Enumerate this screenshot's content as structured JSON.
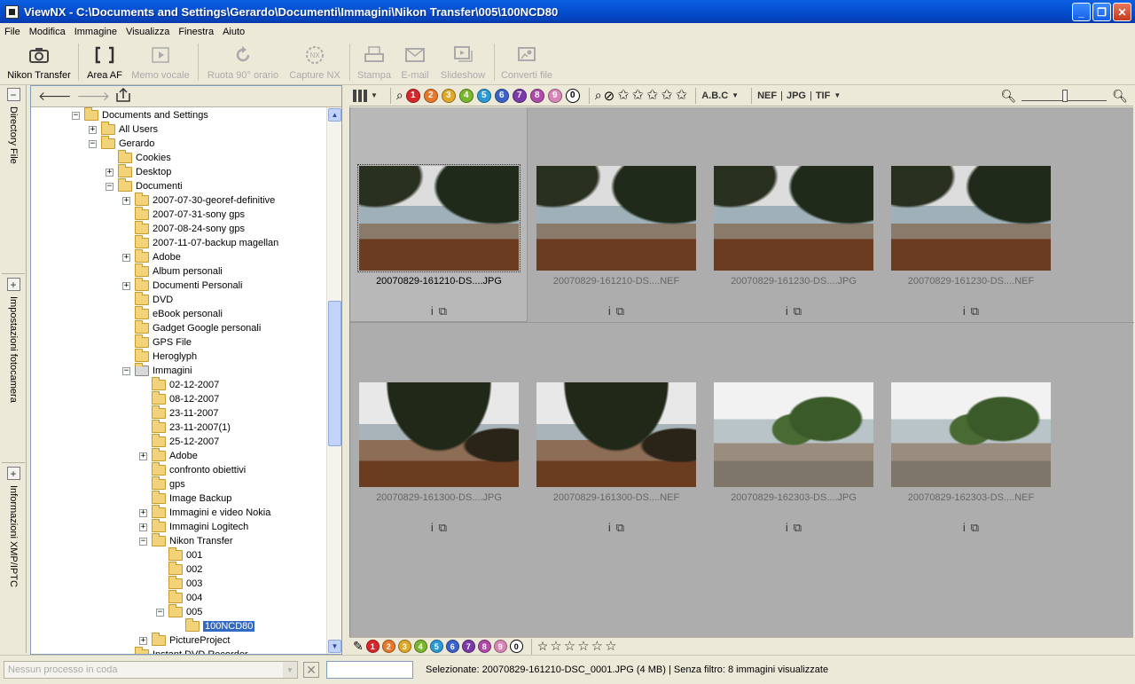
{
  "window": {
    "title": "ViewNX - C:\\Documents and Settings\\Gerardo\\Documenti\\Immagini\\Nikon Transfer\\005\\100NCD80",
    "minimize_glyph": "_",
    "maximize_glyph": "❐",
    "close_glyph": "✕"
  },
  "menu": [
    {
      "label": "File"
    },
    {
      "label": "Modifica"
    },
    {
      "label": "Immagine"
    },
    {
      "label": "Visualizza"
    },
    {
      "label": "Finestra"
    },
    {
      "label": "Aiuto"
    }
  ],
  "toolbar": {
    "nikon_transfer": "Nikon Transfer",
    "area_af": "Area AF",
    "memo_vocale": "Memo vocale",
    "ruota": "Ruota 90° orario",
    "capture_nx": "Capture NX",
    "stampa": "Stampa",
    "email": "E-mail",
    "slideshow": "Slideshow",
    "converti": "Converti file"
  },
  "side_tabs": {
    "directory": "Directory File",
    "camera": "Impostazioni fotocamera",
    "xmp": "Informazioni XMP/IPTC"
  },
  "tree": [
    {
      "label": "Documents and Settings",
      "level": 0,
      "exp": "-"
    },
    {
      "label": "All Users",
      "level": 1,
      "exp": "+"
    },
    {
      "label": "Gerardo",
      "level": 1,
      "exp": "-"
    },
    {
      "label": "Cookies",
      "level": 2,
      "exp": ""
    },
    {
      "label": "Desktop",
      "level": 2,
      "exp": "+"
    },
    {
      "label": "Documenti",
      "level": 2,
      "exp": "-"
    },
    {
      "label": "2007-07-30-georef-definitive",
      "level": 3,
      "exp": "+"
    },
    {
      "label": "2007-07-31-sony gps",
      "level": 3,
      "exp": ""
    },
    {
      "label": "2007-08-24-sony gps",
      "level": 3,
      "exp": ""
    },
    {
      "label": "2007-11-07-backup magellan",
      "level": 3,
      "exp": ""
    },
    {
      "label": "Adobe",
      "level": 3,
      "exp": "+"
    },
    {
      "label": "Album personali",
      "level": 3,
      "exp": ""
    },
    {
      "label": "Documenti Personali",
      "level": 3,
      "exp": "+"
    },
    {
      "label": "DVD",
      "level": 3,
      "exp": ""
    },
    {
      "label": "eBook personali",
      "level": 3,
      "exp": ""
    },
    {
      "label": "Gadget Google personali",
      "level": 3,
      "exp": ""
    },
    {
      "label": "GPS File",
      "level": 3,
      "exp": ""
    },
    {
      "label": "Heroglyph",
      "level": 3,
      "exp": ""
    },
    {
      "label": "Immagini",
      "level": 3,
      "exp": "-",
      "special": true
    },
    {
      "label": "02-12-2007",
      "level": 4,
      "exp": ""
    },
    {
      "label": "08-12-2007",
      "level": 4,
      "exp": ""
    },
    {
      "label": "23-11-2007",
      "level": 4,
      "exp": ""
    },
    {
      "label": "23-11-2007(1)",
      "level": 4,
      "exp": ""
    },
    {
      "label": "25-12-2007",
      "level": 4,
      "exp": ""
    },
    {
      "label": "Adobe",
      "level": 4,
      "exp": "+"
    },
    {
      "label": "confronto obiettivi",
      "level": 4,
      "exp": ""
    },
    {
      "label": "gps",
      "level": 4,
      "exp": ""
    },
    {
      "label": "Image Backup",
      "level": 4,
      "exp": ""
    },
    {
      "label": "Immagini e video Nokia",
      "level": 4,
      "exp": "+"
    },
    {
      "label": "Immagini Logitech",
      "level": 4,
      "exp": "+"
    },
    {
      "label": "Nikon Transfer",
      "level": 4,
      "exp": "-"
    },
    {
      "label": "001",
      "level": 5,
      "exp": ""
    },
    {
      "label": "002",
      "level": 5,
      "exp": ""
    },
    {
      "label": "003",
      "level": 5,
      "exp": ""
    },
    {
      "label": "004",
      "level": 5,
      "exp": ""
    },
    {
      "label": "005",
      "level": 5,
      "exp": "-"
    },
    {
      "label": "100NCD80",
      "level": 6,
      "exp": "",
      "selected": true
    },
    {
      "label": "PictureProject",
      "level": 4,
      "exp": "+"
    },
    {
      "label": "Instant DVD Recorder",
      "level": 3,
      "exp": ""
    }
  ],
  "label_filters": [
    {
      "n": "1",
      "color": "#d8262a"
    },
    {
      "n": "2",
      "color": "#e8792a"
    },
    {
      "n": "3",
      "color": "#e0a82a"
    },
    {
      "n": "4",
      "color": "#7ab62e"
    },
    {
      "n": "5",
      "color": "#2a9ad6"
    },
    {
      "n": "6",
      "color": "#3a62c8"
    },
    {
      "n": "7",
      "color": "#7a3aa8"
    },
    {
      "n": "8",
      "color": "#b04aa8"
    },
    {
      "n": "9",
      "color": "#d886b8"
    },
    {
      "n": "0",
      "color": "#ffffff"
    }
  ],
  "filter_text": {
    "abc": "A.B.C",
    "nef": "NEF",
    "jpg": "JPG",
    "tif": "TIF",
    "sep1": "|",
    "sep2": "|"
  },
  "thumbnails": [
    {
      "name": "20070829-161210-DS....JPG",
      "scene": "a",
      "selected": true
    },
    {
      "name": "20070829-161210-DS....NEF",
      "scene": "a"
    },
    {
      "name": "20070829-161230-DS....JPG",
      "scene": "a"
    },
    {
      "name": "20070829-161230-DS....NEF",
      "scene": "a"
    },
    {
      "name": "20070829-161300-DS....JPG",
      "scene": "b"
    },
    {
      "name": "20070829-161300-DS....NEF",
      "scene": "b"
    },
    {
      "name": "20070829-162303-DS....JPG",
      "scene": "c"
    },
    {
      "name": "20070829-162303-DS....NEF",
      "scene": "c"
    }
  ],
  "status": {
    "queue": "Nessun processo in coda",
    "text": "Selezionate: 20070829-161210-DSC_0001.JPG (4 MB) | Senza filtro: 8 immagini visualizzate"
  }
}
